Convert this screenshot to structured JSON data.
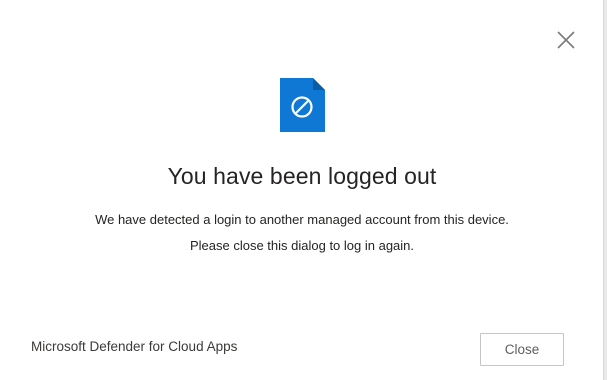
{
  "dialog": {
    "title": "You have been logged out",
    "message_line1": "We have detected a login to another managed account from this device.",
    "message_line2": "Please close this dialog to log in again.",
    "brand": "Microsoft Defender for Cloud Apps",
    "close_button_label": "Close",
    "icons": {
      "dismiss": "close-icon",
      "status": "blocked-file-icon"
    },
    "colors": {
      "icon_blue": "#0f78d4",
      "icon_fold": "#0a5ca5",
      "text": "#252423"
    }
  }
}
